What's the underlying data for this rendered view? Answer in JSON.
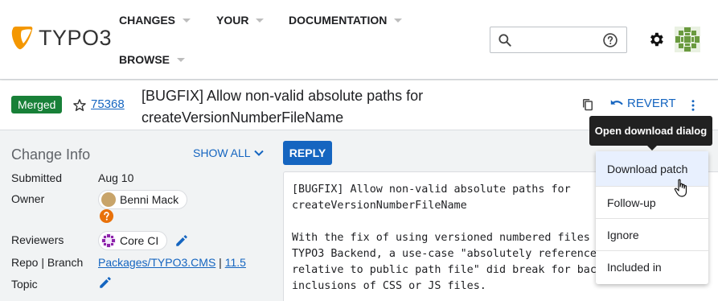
{
  "header": {
    "logo_text": "TYPO3",
    "nav": [
      {
        "label": "CHANGES"
      },
      {
        "label": "YOUR"
      },
      {
        "label": "DOCUMENTATION"
      },
      {
        "label": "BROWSE"
      }
    ],
    "icons": {
      "search": "search-icon",
      "help": "help-circle-icon",
      "settings": "gear-icon",
      "avatar": "user-avatar"
    }
  },
  "change": {
    "status": "Merged",
    "number": "75368",
    "title": "[BUGFIX] Allow non-valid absolute paths for createVersionNumberFileName",
    "revert_label": "REVERT"
  },
  "info": {
    "title": "Change Info",
    "show_all": "SHOW ALL",
    "submitted_label": "Submitted",
    "submitted_value": "Aug 10",
    "owner_label": "Owner",
    "owner_name": "Benni Mack",
    "reviewers_label": "Reviewers",
    "reviewer_name": "Core CI",
    "repo_label": "Repo | Branch",
    "repo_value": "Packages/TYPO3.CMS",
    "repo_sep": " | ",
    "branch_value": "11.5",
    "topic_label": "Topic"
  },
  "reply_label": "REPLY",
  "commit_message": "[BUGFIX] Allow non-valid absolute paths for\ncreateVersionNumberFileName\n\nWith the fix of using versioned numbered files in\nTYPO3 Backend, a use-case \"absolutely referenced\nrelative to public path file\" did break for backend\ninclusions of CSS or JS files.",
  "tooltip": "Open download dialog",
  "dropdown": [
    {
      "label": "Download patch"
    },
    {
      "label": "Follow-up"
    },
    {
      "label": "Ignore"
    },
    {
      "label": "Included in"
    }
  ],
  "colors": {
    "accent": "#1565c0",
    "merged": "#188038",
    "logo": "#f49700"
  }
}
